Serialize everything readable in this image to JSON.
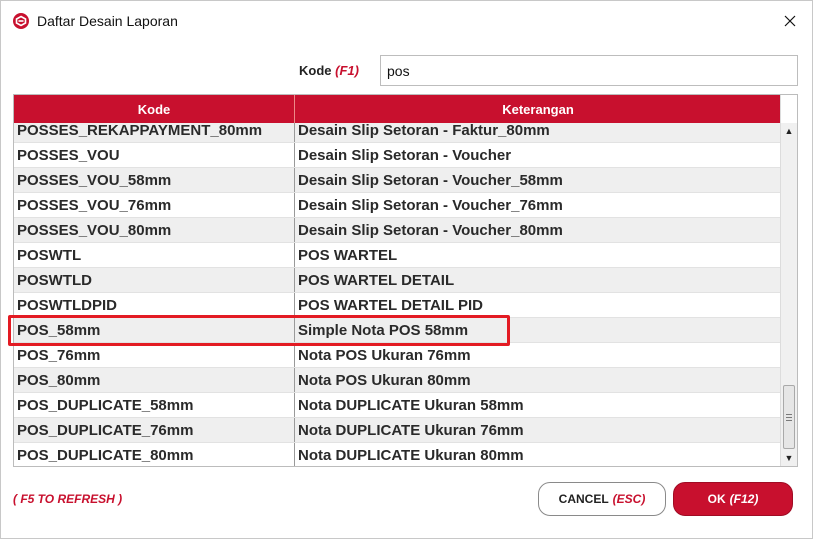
{
  "window": {
    "title": "Daftar Desain Laporan",
    "accent_color": "#c8102e",
    "app_icon": "app-logo-icon",
    "close_icon": "close-icon"
  },
  "search": {
    "label": "Kode",
    "shortcut": "(F1)",
    "value": "pos"
  },
  "table": {
    "columns": [
      "Kode",
      "Keterangan"
    ],
    "rows": [
      {
        "kode": "POSSES_REKAPPAYMENT_80mm",
        "keterangan": "Desain Slip Setoran - Faktur_80mm"
      },
      {
        "kode": "POSSES_VOU",
        "keterangan": "Desain Slip Setoran - Voucher"
      },
      {
        "kode": "POSSES_VOU_58mm",
        "keterangan": "Desain Slip Setoran - Voucher_58mm"
      },
      {
        "kode": "POSSES_VOU_76mm",
        "keterangan": "Desain Slip Setoran - Voucher_76mm"
      },
      {
        "kode": "POSSES_VOU_80mm",
        "keterangan": "Desain Slip Setoran - Voucher_80mm"
      },
      {
        "kode": "POSWTL",
        "keterangan": "POS WARTEL"
      },
      {
        "kode": "POSWTLD",
        "keterangan": "POS WARTEL DETAIL"
      },
      {
        "kode": "POSWTLDPID",
        "keterangan": "POS WARTEL DETAIL PID"
      },
      {
        "kode": "POS_58mm",
        "keterangan": "Simple Nota POS 58mm"
      },
      {
        "kode": "POS_76mm",
        "keterangan": "Nota POS Ukuran 76mm"
      },
      {
        "kode": "POS_80mm",
        "keterangan": "Nota POS Ukuran 80mm"
      },
      {
        "kode": "POS_DUPLICATE_58mm",
        "keterangan": "Nota DUPLICATE Ukuran 58mm"
      },
      {
        "kode": "POS_DUPLICATE_76mm",
        "keterangan": "Nota DUPLICATE Ukuran 76mm"
      },
      {
        "kode": "POS_DUPLICATE_80mm",
        "keterangan": "Nota DUPLICATE Ukuran 80mm"
      }
    ],
    "highlighted_row": "POS_58mm",
    "highlight_color": "#e31b23"
  },
  "footer": {
    "refresh_hint": "( F5 TO REFRESH )",
    "cancel_label": "CANCEL",
    "cancel_shortcut": "(ESC)",
    "ok_label": "OK",
    "ok_shortcut": "(F12)"
  }
}
